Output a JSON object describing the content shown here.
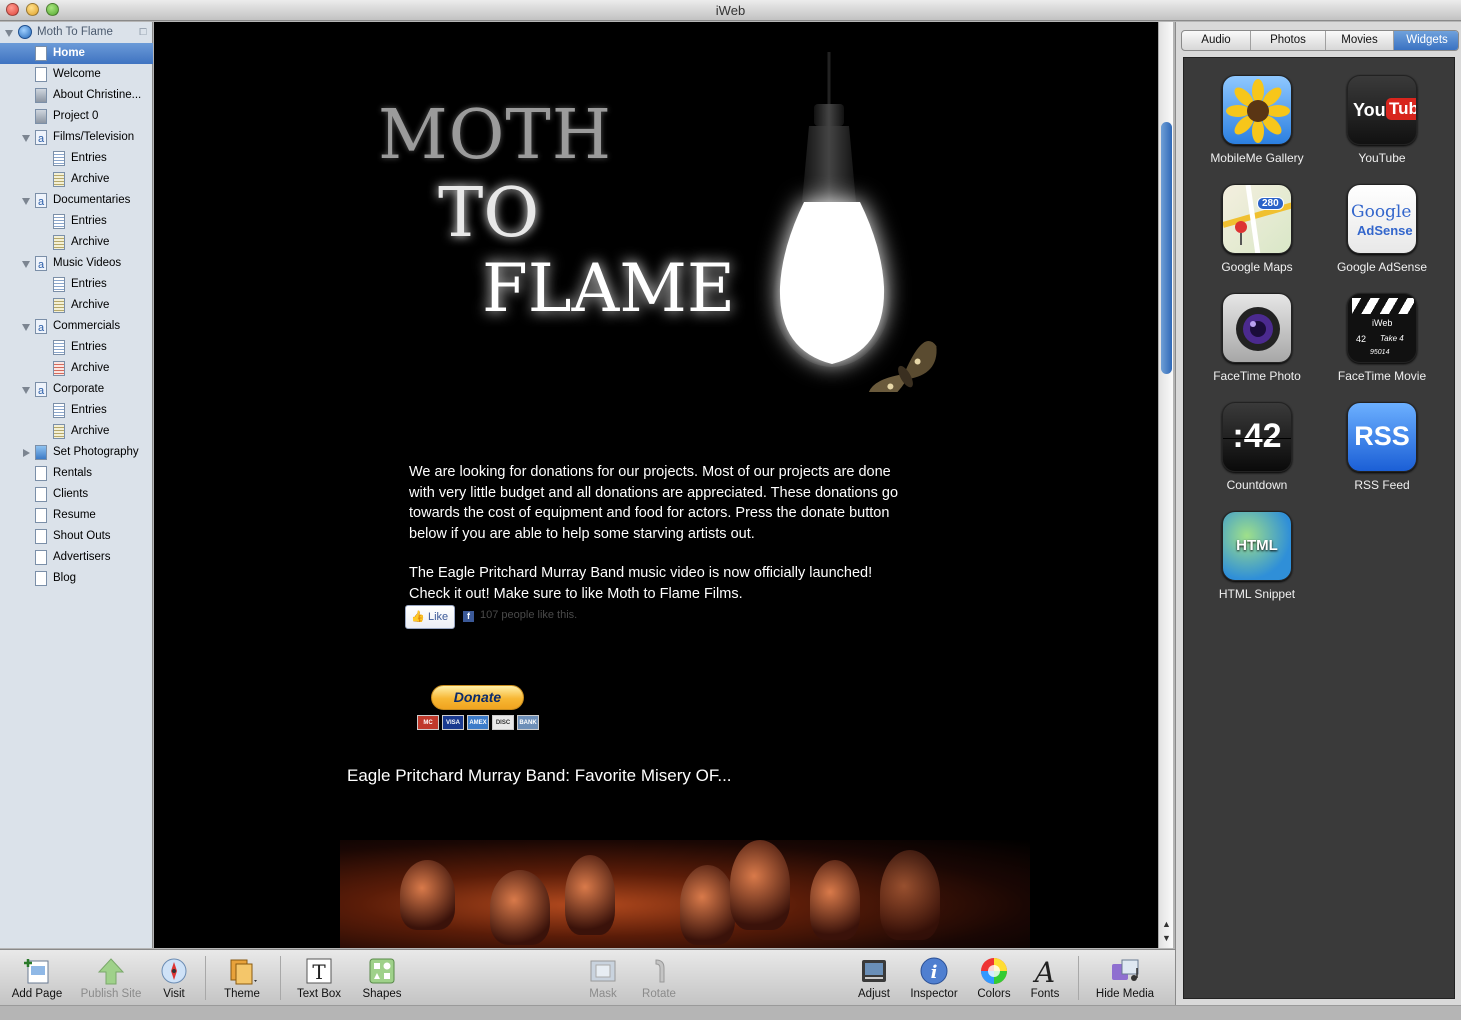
{
  "window": {
    "title": "iWeb"
  },
  "sidebar": {
    "site_name": "Moth To Flame",
    "items": [
      {
        "label": "Home",
        "icon": "page-icon",
        "selected": true
      },
      {
        "label": "Welcome",
        "icon": "page-icon"
      },
      {
        "label": "About Christine...",
        "icon": "person-page-icon"
      },
      {
        "label": "Project 0",
        "icon": "person-page-icon"
      },
      {
        "label": "Films/Television",
        "icon": "blog-icon"
      },
      {
        "label": "Entries",
        "icon": "entries-icon"
      },
      {
        "label": "Archive",
        "icon": "archive-icon"
      },
      {
        "label": "Documentaries",
        "icon": "blog-icon"
      },
      {
        "label": "Entries",
        "icon": "entries-icon"
      },
      {
        "label": "Archive",
        "icon": "archive-icon"
      },
      {
        "label": "Music Videos",
        "icon": "blog-icon"
      },
      {
        "label": "Entries",
        "icon": "entries-icon"
      },
      {
        "label": "Archive",
        "icon": "archive-icon"
      },
      {
        "label": "Commercials",
        "icon": "blog-icon"
      },
      {
        "label": "Entries",
        "icon": "entries-icon"
      },
      {
        "label": "Archive",
        "icon": "archive-icon"
      },
      {
        "label": "Corporate",
        "icon": "blog-icon"
      },
      {
        "label": "Entries",
        "icon": "entries-icon"
      },
      {
        "label": "Archive",
        "icon": "archive-icon"
      },
      {
        "label": "Set Photography",
        "icon": "photo-page-icon"
      },
      {
        "label": "Rentals",
        "icon": "page-icon"
      },
      {
        "label": "Clients",
        "icon": "page-icon"
      },
      {
        "label": "Resume",
        "icon": "page-icon"
      },
      {
        "label": "Shout Outs",
        "icon": "page-icon"
      },
      {
        "label": "Advertisers",
        "icon": "page-icon"
      },
      {
        "label": "Blog",
        "icon": "page-icon"
      }
    ]
  },
  "page": {
    "title_words": [
      "MOTH",
      "TO",
      "FLAME"
    ],
    "intro": "We are looking for donations for our projects. Most of our projects are done\nwith very little budget and all donations are appreciated. These donations go\ntowards the cost of equipment and food for actors.  Press the donate button\nbelow if you are able to help some starving artists out.",
    "launch": "The Eagle Pritchard Murray Band music video is now officially launched!\nCheck it out! Make sure to like Moth to Flame Films.",
    "like_label": "Like",
    "like_count": "107 people like this.",
    "donate_label": "Donate",
    "cards": [
      "MC",
      "VISA",
      "AMEX",
      "DISC",
      "BANK"
    ],
    "video_title": "Eagle Pritchard Murray Band: Favorite Misery OF..."
  },
  "toolbar": {
    "add_page": "Add Page",
    "publish_site": "Publish Site",
    "visit": "Visit",
    "theme": "Theme",
    "text_box": "Text Box",
    "shapes": "Shapes",
    "mask": "Mask",
    "rotate": "Rotate",
    "adjust": "Adjust",
    "inspector": "Inspector",
    "colors": "Colors",
    "fonts": "Fonts",
    "hide_media": "Hide Media"
  },
  "media": {
    "tabs": [
      "Audio",
      "Photos",
      "Movies",
      "Widgets"
    ],
    "selected_tab": "Widgets",
    "widgets": [
      {
        "label": "MobileMe Gallery",
        "icon": "sunflower-icon"
      },
      {
        "label": "YouTube",
        "icon": "youtube-icon"
      },
      {
        "label": "Google Maps",
        "icon": "maps-icon"
      },
      {
        "label": "Google AdSense",
        "icon": "adsense-icon"
      },
      {
        "label": "FaceTime Photo",
        "icon": "camera-icon"
      },
      {
        "label": "FaceTime Movie",
        "icon": "clapperboard-icon"
      },
      {
        "label": "Countdown",
        "icon": "countdown-icon",
        "display": ":42"
      },
      {
        "label": "RSS Feed",
        "icon": "rss-icon",
        "display": "RSS"
      },
      {
        "label": "HTML Snippet",
        "icon": "html-icon",
        "display": "HTML"
      }
    ],
    "youtube_logo": [
      "You",
      "Tube"
    ],
    "maps_badge": "280",
    "adsense_logo": [
      "Google",
      "AdSense"
    ],
    "clapper_text": [
      "iWeb",
      "42",
      "Take 4",
      "95014"
    ]
  },
  "colors": {
    "accent": "#3f73c1",
    "canvas": "#000000",
    "sidebar": "#dbe2ea",
    "widget_panel": "#3a3a3a"
  }
}
